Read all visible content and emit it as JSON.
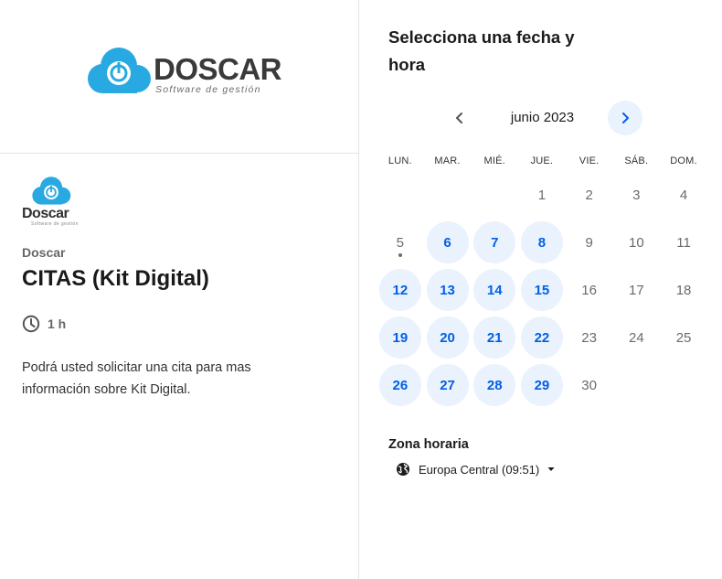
{
  "brand": {
    "name": "DOSCAR",
    "tagline": "Software de gestión",
    "small_name": "Doscar",
    "small_tagline": "Software de gestión",
    "color": "#29a9e1"
  },
  "event": {
    "owner": "Doscar",
    "title": "CITAS (Kit Digital)",
    "duration": "1 h",
    "description": "Podrá usted solicitar una cita para mas información sobre Kit Digital."
  },
  "calendar": {
    "heading": "Selecciona una fecha y hora",
    "month_label": "junio 2023",
    "prev_icon": "chevron-left-icon",
    "next_icon": "chevron-right-icon",
    "weekdays": [
      "LUN.",
      "MAR.",
      "MIÉ.",
      "JUE.",
      "VIE.",
      "SÁB.",
      "DOM."
    ],
    "first_weekday_index": 3,
    "today": 5,
    "days": [
      {
        "day": "1",
        "available": false
      },
      {
        "day": "2",
        "available": false
      },
      {
        "day": "3",
        "available": false
      },
      {
        "day": "4",
        "available": false
      },
      {
        "day": "5",
        "available": false
      },
      {
        "day": "6",
        "available": true
      },
      {
        "day": "7",
        "available": true
      },
      {
        "day": "8",
        "available": true
      },
      {
        "day": "9",
        "available": false
      },
      {
        "day": "10",
        "available": false
      },
      {
        "day": "11",
        "available": false
      },
      {
        "day": "12",
        "available": true
      },
      {
        "day": "13",
        "available": true
      },
      {
        "day": "14",
        "available": true
      },
      {
        "day": "15",
        "available": true
      },
      {
        "day": "16",
        "available": false
      },
      {
        "day": "17",
        "available": false
      },
      {
        "day": "18",
        "available": false
      },
      {
        "day": "19",
        "available": true
      },
      {
        "day": "20",
        "available": true
      },
      {
        "day": "21",
        "available": true
      },
      {
        "day": "22",
        "available": true
      },
      {
        "day": "23",
        "available": false
      },
      {
        "day": "24",
        "available": false
      },
      {
        "day": "25",
        "available": false
      },
      {
        "day": "26",
        "available": true
      },
      {
        "day": "27",
        "available": true
      },
      {
        "day": "28",
        "available": true
      },
      {
        "day": "29",
        "available": true
      },
      {
        "day": "30",
        "available": false
      }
    ]
  },
  "timezone": {
    "title": "Zona horaria",
    "value": "Europa Central (09:51)",
    "icon": "globe-icon",
    "caret_icon": "caret-down-icon"
  },
  "colors": {
    "accent": "#0060e6",
    "available_bg": "#eaf2fe",
    "divider": "#e3e3e3"
  }
}
